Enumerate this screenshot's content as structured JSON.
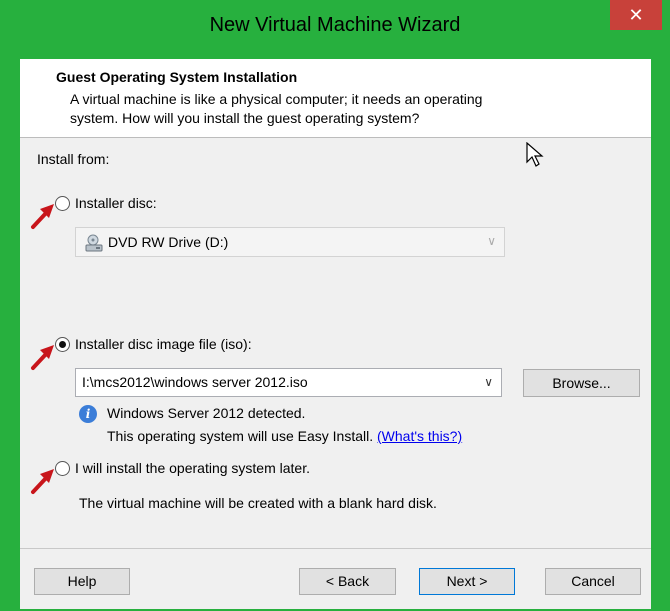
{
  "window": {
    "title": "New Virtual Machine Wizard",
    "close_glyph": "✕"
  },
  "header": {
    "title": "Guest Operating System Installation",
    "description_line1": "A virtual machine is like a physical computer; it needs an operating",
    "description_line2": "system. How will you install the guest operating system?"
  },
  "install_from": {
    "label": "Install from:",
    "options": [
      {
        "label": "Installer disc:",
        "checked": false
      },
      {
        "label": "Installer disc image file (iso):",
        "checked": true
      },
      {
        "label": "I will install the operating system later.",
        "checked": false
      }
    ],
    "disc_drive": {
      "value": "DVD RW Drive (D:)",
      "icon": "dvd-drive-icon",
      "enabled": false
    },
    "iso_path": {
      "value": "I:\\mcs2012\\windows server 2012.iso"
    },
    "browse_label": "Browse...",
    "detected_line1": "Windows Server 2012 detected.",
    "detected_line2": "This operating system will use Easy Install.",
    "whats_this": "(What's this?)",
    "later_note": "The virtual machine will be created with a blank hard disk."
  },
  "footer": {
    "help": "Help",
    "back": "< Back",
    "next": "Next >",
    "cancel": "Cancel"
  },
  "colors": {
    "frame": "#27b03e",
    "close": "#c8413a",
    "arrow": "#c8151b",
    "link": "#0000ee"
  }
}
